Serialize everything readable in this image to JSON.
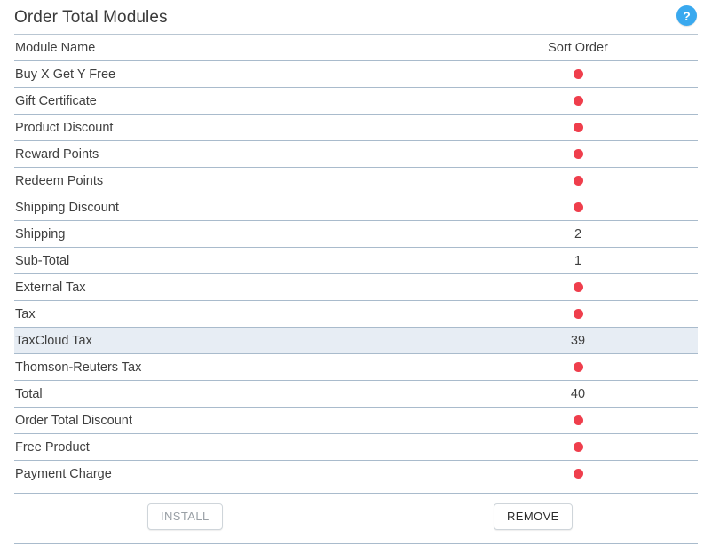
{
  "header": {
    "title": "Order Total Modules",
    "help_icon": "question-mark-icon",
    "help_label": "?",
    "help_color": "#39a9ef"
  },
  "table": {
    "columns": [
      "Module Name",
      "Sort Order"
    ],
    "dot_color": "#ef3e4c",
    "highlight_color": "#e7edf4",
    "rows": [
      {
        "name": "Buy X Get Y Free",
        "sort_order": null,
        "sort_display": "",
        "installed": false,
        "selected": false
      },
      {
        "name": "Gift Certificate",
        "sort_order": null,
        "sort_display": "",
        "installed": false,
        "selected": false
      },
      {
        "name": "Product Discount",
        "sort_order": null,
        "sort_display": "",
        "installed": false,
        "selected": false
      },
      {
        "name": "Reward Points",
        "sort_order": null,
        "sort_display": "",
        "installed": false,
        "selected": false
      },
      {
        "name": "Redeem Points",
        "sort_order": null,
        "sort_display": "",
        "installed": false,
        "selected": false
      },
      {
        "name": "Shipping Discount",
        "sort_order": null,
        "sort_display": "",
        "installed": false,
        "selected": false
      },
      {
        "name": "Shipping",
        "sort_order": 2,
        "sort_display": "2",
        "installed": true,
        "selected": false
      },
      {
        "name": "Sub-Total",
        "sort_order": 1,
        "sort_display": "1",
        "installed": true,
        "selected": false
      },
      {
        "name": "External Tax",
        "sort_order": null,
        "sort_display": "",
        "installed": false,
        "selected": false
      },
      {
        "name": "Tax",
        "sort_order": null,
        "sort_display": "",
        "installed": false,
        "selected": false
      },
      {
        "name": "TaxCloud Tax",
        "sort_order": 39,
        "sort_display": "39",
        "installed": true,
        "selected": true
      },
      {
        "name": "Thomson-Reuters Tax",
        "sort_order": null,
        "sort_display": "",
        "installed": false,
        "selected": false
      },
      {
        "name": "Total",
        "sort_order": 40,
        "sort_display": "40",
        "installed": true,
        "selected": false
      },
      {
        "name": "Order Total Discount",
        "sort_order": null,
        "sort_display": "",
        "installed": false,
        "selected": false
      },
      {
        "name": "Free Product",
        "sort_order": null,
        "sort_display": "",
        "installed": false,
        "selected": false
      },
      {
        "name": "Payment Charge",
        "sort_order": null,
        "sort_display": "",
        "installed": false,
        "selected": false
      }
    ]
  },
  "actions": {
    "install_label": "INSTALL",
    "install_disabled": true,
    "remove_label": "REMOVE",
    "remove_disabled": false
  }
}
